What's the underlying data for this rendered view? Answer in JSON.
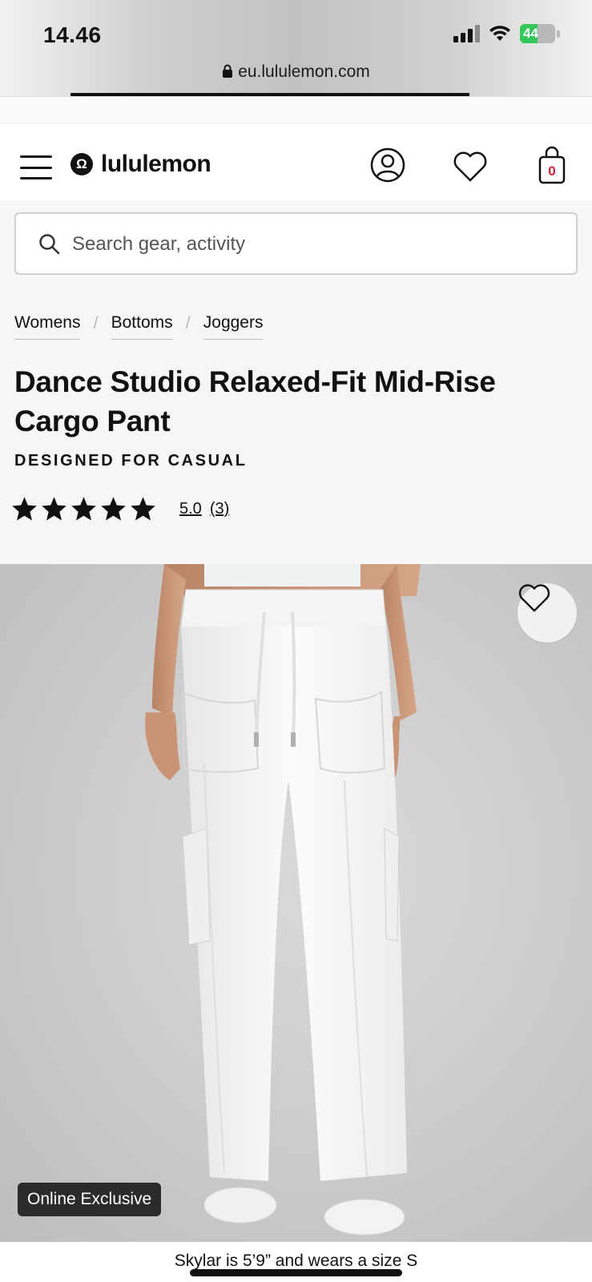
{
  "status_bar": {
    "time": "14.46",
    "battery": "44",
    "url": "eu.lululemon.com"
  },
  "header": {
    "brand": "lululemon",
    "brand_mark": "Ω",
    "icons": [
      "menu-icon",
      "account-icon",
      "heart-icon",
      "bag-icon"
    ],
    "cart_count": "0"
  },
  "search": {
    "placeholder": "Search gear, activity"
  },
  "breadcrumb": {
    "items": [
      "Womens",
      "Bottoms",
      "Joggers"
    ],
    "separator": "/"
  },
  "product": {
    "title": "Dance Studio Relaxed-Fit Mid-Rise Cargo Pant",
    "designed_for": "DESIGNED FOR CASUAL",
    "rating": {
      "stars": 5,
      "value": "5.0",
      "count": "(3)"
    },
    "badge": "Online Exclusive",
    "model_caption": "Skylar is 5’9” and wears a size S"
  },
  "colors": {
    "brand_red": "#d31f3a",
    "battery_green": "#34c759",
    "badge_bg": "#2b2b2b"
  }
}
